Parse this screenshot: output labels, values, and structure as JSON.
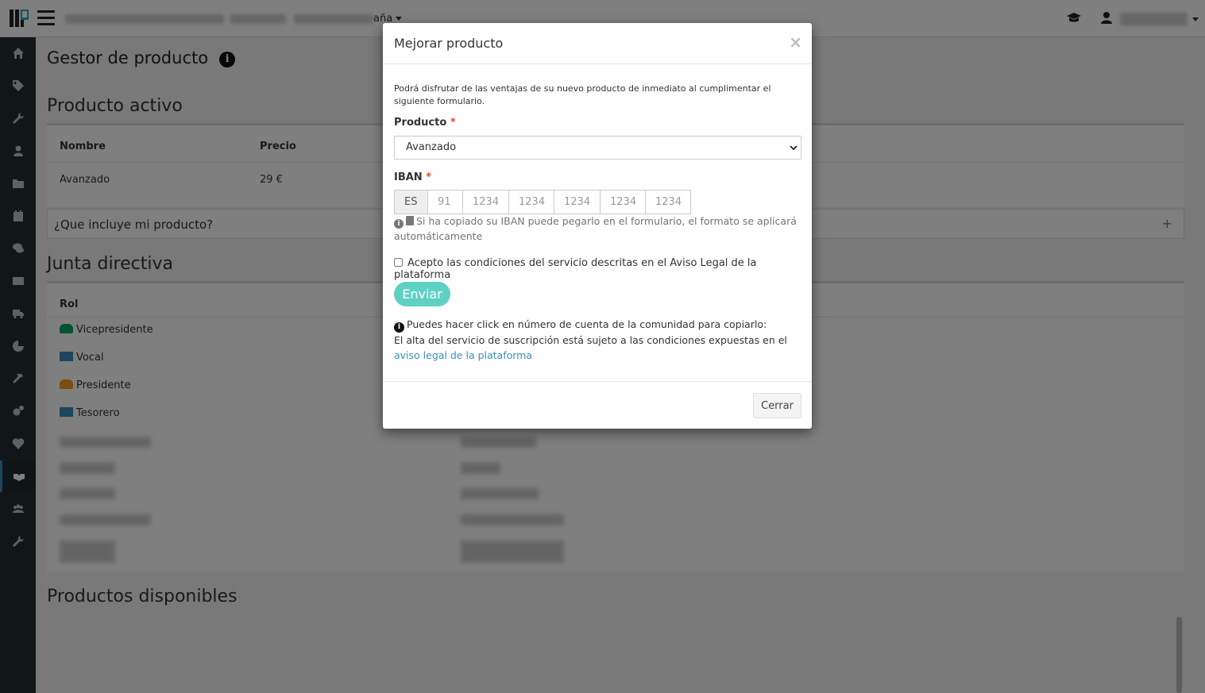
{
  "topbar": {
    "location_text": "aña",
    "icons": [
      "graduation-cap-icon",
      "user-icon"
    ]
  },
  "sidebar": {
    "items": [
      "home-icon",
      "tags-icon",
      "wrench-icon",
      "user-icon",
      "folder-icon",
      "calendar-icon",
      "comments-icon",
      "envelope-icon",
      "truck-icon",
      "pie-chart-icon",
      "hammer-icon",
      "cogs-icon",
      "heart-icon",
      "handshake-icon",
      "users-icon",
      "wrench-icon"
    ],
    "active_index": 13
  },
  "page": {
    "title": "Gestor de producto",
    "active_product_title": "Producto activo",
    "table_headers": {
      "name": "Nombre",
      "price": "Precio"
    },
    "active_product": {
      "name": "Avanzado",
      "price": "29 €"
    },
    "accordion_label": "¿Que incluye mi producto?",
    "accordion_toggle": "+",
    "board_title": "Junta directiva",
    "board_header": "Rol",
    "roles": [
      {
        "label": "Vicepresidente",
        "color": "#00a65a"
      },
      {
        "label": "Vocal",
        "color": "#3c8dbc"
      },
      {
        "label": "Presidente",
        "color": "#f39c12"
      },
      {
        "label": "Tesorero",
        "color": "#3c8dbc"
      }
    ],
    "available_title": "Productos disponibles"
  },
  "modal": {
    "title": "Mejorar producto",
    "close_symbol": "×",
    "intro": "Podrá disfrutar de las ventajas de su nuevo producto de inmediato al cumplimentar el siguiente formulario.",
    "product_label": "Producto",
    "required_mark": "*",
    "product_value": "Avanzado",
    "iban_label": "IBAN",
    "iban_prefix": "ES",
    "iban_placeholders": [
      "91",
      "1234",
      "1234",
      "1234",
      "1234",
      "1234"
    ],
    "iban_hint": "Si ha copiado su IBAN puede pegarlo en el formulario, el formato se aplicará automáticamente",
    "accept_text": "Acepto las condiciones del servicio descritas en el Aviso Legal de la plataforma",
    "send_label": "Enviar",
    "note_line1": "Puedes hacer click en número de cuenta de la comunidad para copiarlo:",
    "note_line2": "El alta del servicio de suscripción está sujeto a las condiciones expuestas en el",
    "note_link": "aviso legal de la plataforma",
    "close_label": "Cerrar",
    "accent_color": "#5fd0c4"
  }
}
